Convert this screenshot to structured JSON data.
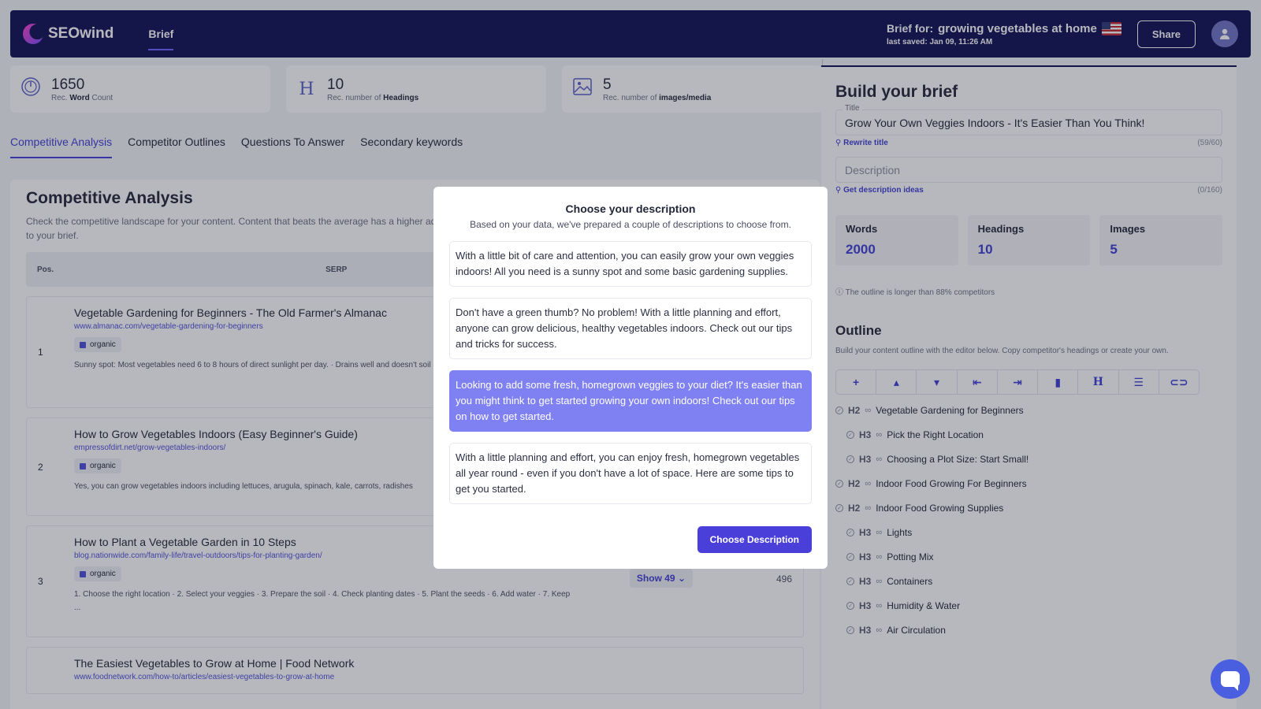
{
  "header": {
    "logo_text": "SEOwind",
    "nav_brief": "Brief",
    "brief_for_label": "Brief for:",
    "brief_topic": "growing vegetables at home",
    "last_saved": "last saved: Jan 09, 11:26 AM",
    "share_label": "Share"
  },
  "stats": [
    {
      "value": "1650",
      "label_pre": "Rec. ",
      "label_bold": "Word",
      "label_post": " Count"
    },
    {
      "value": "10",
      "label_pre": "Rec. number of ",
      "label_bold": "Headings",
      "label_post": ""
    },
    {
      "value": "5",
      "label_pre": "Rec. number of ",
      "label_bold": "images/media",
      "label_post": ""
    }
  ],
  "tabs": [
    "Competitive Analysis",
    "Competitor Outlines",
    "Questions To Answer",
    "Secondary keywords"
  ],
  "analysis": {
    "title": "Competitive Analysis",
    "desc": "Check the competitive landscape for your content. Content that beats the average has a higher add them to your brief.",
    "col_pos": "Pos.",
    "col_serp": "SERP",
    "rows": [
      {
        "pos": "1",
        "title": "Vegetable Gardening for Beginners - The Old Farmer's Almanac",
        "url": "www.almanac.com/vegetable-gardening-for-beginners",
        "badge": "organic",
        "snippet": "Sunny spot: Most vegetables need 6 to 8 hours of direct sunlight per day. · Drains well and doesn't soil ..."
      },
      {
        "pos": "2",
        "title": "How to Grow Vegetables Indoors (Easy Beginner's Guide)",
        "url": "empressofdirt.net/grow-vegetables-indoors/",
        "badge": "organic",
        "snippet": "Yes, you can grow vegetables indoors including lettuces, arugula, spinach, kale, carrots, radishes"
      },
      {
        "pos": "3",
        "title": "How to Plant a Vegetable Garden in 10 Steps",
        "url": "blog.nationwide.com/family-life/travel-outdoors/tips-for-planting-garden/",
        "badge": "organic",
        "snippet": "1. Choose the right location · 2. Select your veggies · 3. Prepare the soil · 4. Check planting dates · 5. Plant the seeds · 6. Add water · 7. Keep ...",
        "show": "Show 49",
        "count": "496"
      },
      {
        "pos": "",
        "title": "The Easiest Vegetables to Grow at Home | Food Network",
        "url": "www.foodnetwork.com/how-to/articles/easiest-vegetables-to-grow-at-home",
        "badge": "",
        "snippet": ""
      }
    ]
  },
  "brief": {
    "title": "Build your brief",
    "title_label": "Title",
    "title_value": "Grow Your Own Veggies Indoors - It's Easier Than You Think!",
    "rewrite_title": "Rewrite title",
    "title_count": "(59/60)",
    "desc_placeholder": "Description",
    "desc_ideas": "Get description ideas",
    "desc_count": "(0/160)",
    "metrics": [
      {
        "label": "Words",
        "value": "2000"
      },
      {
        "label": "Headings",
        "value": "10"
      },
      {
        "label": "Images",
        "value": "5"
      }
    ],
    "note": "The outline is longer than 88% competitors",
    "outline_title": "Outline",
    "outline_desc": "Build your content outline with the editor below. Copy competitor's headings or create your own.",
    "outline": [
      {
        "level": "H2",
        "text": "Vegetable Gardening for Beginners"
      },
      {
        "level": "H3",
        "text": "Pick the Right Location"
      },
      {
        "level": "H3",
        "text": "Choosing a Plot Size: Start Small!"
      },
      {
        "level": "H2",
        "text": "Indoor Food Growing For Beginners"
      },
      {
        "level": "H2",
        "text": "Indoor Food Growing Supplies"
      },
      {
        "level": "H3",
        "text": "Lights"
      },
      {
        "level": "H3",
        "text": "Potting Mix"
      },
      {
        "level": "H3",
        "text": "Containers"
      },
      {
        "level": "H3",
        "text": "Humidity & Water"
      },
      {
        "level": "H3",
        "text": "Air Circulation"
      }
    ]
  },
  "modal": {
    "title": "Choose your description",
    "subtitle": "Based on your data, we've prepared a couple of descriptions to choose from.",
    "options": [
      "With a little bit of care and attention, you can easily grow your own veggies indoors! All you need is a sunny spot and some basic gardening supplies.",
      "Don't have a green thumb? No problem! With a little planning and effort, anyone can grow delicious, healthy vegetables indoors. Check out our tips and tricks for success.",
      "Looking to add some fresh, homegrown veggies to your diet? It's easier than you might think to get started growing your own indoors! Check out our tips on how to get started.",
      "With a little planning and effort, you can enjoy fresh, homegrown vegetables all year round - even if you don't have a lot of space. Here are some tips to get you started."
    ],
    "selected_index": 2,
    "button": "Choose Description"
  },
  "colors": {
    "navy": "#101156",
    "accent": "#4a40d9",
    "selected": "#7f80f2"
  }
}
